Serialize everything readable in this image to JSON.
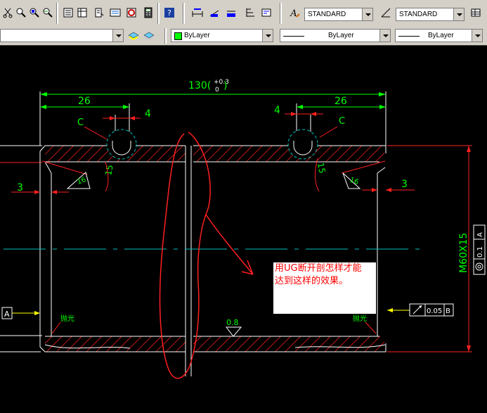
{
  "toolbar": {
    "text_style": "STANDARD",
    "dim_style": "STANDARD",
    "layer_value": "",
    "color_value": "ByLayer",
    "linetype_value": "ByLayer",
    "lineweight_value": "ByLayer"
  },
  "drawing": {
    "overall_dim": "130(",
    "tol_upper": "+0.3",
    "tol_lower": "0",
    "left_dim_26": "26",
    "right_dim_26": "26",
    "left_dim_4": "4",
    "right_dim_4": "4",
    "label_c_left": "C",
    "label_c_right": "C",
    "left_dim_3": "3",
    "right_dim_3": "3",
    "angle_left": "15",
    "angle_right": "15",
    "rough_left": "16",
    "rough_right": "16",
    "rough_bottom": "0.8",
    "thread": "M60X15",
    "datum_a": "A",
    "fcf_left_tol": "0.05",
    "fcf_left_datum": "B",
    "fcf_right_tol": "0.1",
    "fcf_right_datum": "A",
    "polish_left": "抛光",
    "polish_right": "抛光",
    "note_line1": "用UG断开剖怎样才能",
    "note_line2": "达到这样的效果。"
  },
  "colors": {
    "toolbar_bg": "#d4d0c8",
    "canvas_bg": "#000000",
    "geometry": "#ffffff",
    "dimension": "#00ff00",
    "hatch": "#ff0000",
    "center_line": "#00c0c0",
    "markup": "#ff0000"
  },
  "icons": [
    "cut-icon",
    "copy-icon",
    "zoom-icon",
    "zoom-window-icon",
    "zoom-previous-icon",
    "properties-icon",
    "design-center-icon",
    "tool-palette-icon",
    "sheet-set-icon",
    "markup-icon",
    "calculator-icon",
    "help-icon",
    "dim-style-icon",
    "text-style-icon",
    "layer-properties-icon",
    "layer-states-icon"
  ]
}
